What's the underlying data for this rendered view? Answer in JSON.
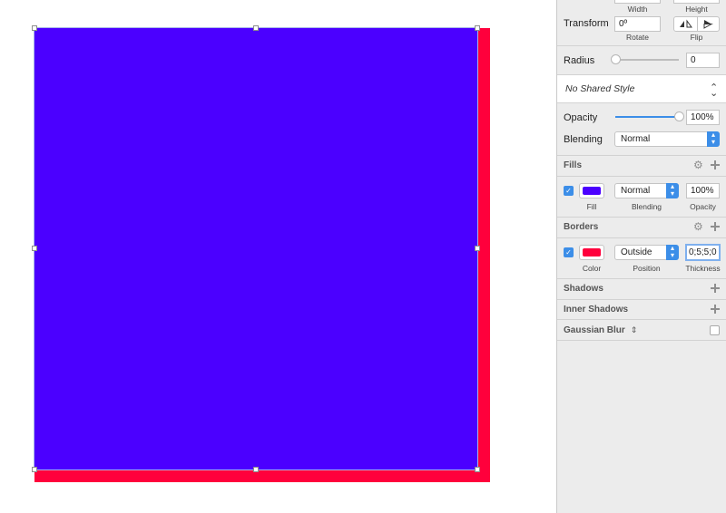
{
  "colors": {
    "fill": "#4b00ff",
    "border": "#ff003c",
    "accent": "#3c8ee8"
  },
  "size": {
    "width_label": "Width",
    "height_label": "Height"
  },
  "transform": {
    "label": "Transform",
    "rotate_value": "0º",
    "rotate_label": "Rotate",
    "flip_label": "Flip"
  },
  "radius": {
    "label": "Radius",
    "value": "0",
    "slider_fraction": 0
  },
  "shared_style": {
    "value": "No Shared Style"
  },
  "opacity": {
    "label": "Opacity",
    "value": "100%",
    "slider_fraction": 1.0
  },
  "blending": {
    "label": "Blending",
    "value": "Normal"
  },
  "fills": {
    "title": "Fills",
    "item": {
      "enabled": true,
      "blending": "Normal",
      "opacity": "100%",
      "fill_label": "Fill",
      "blending_label": "Blending",
      "opacity_label": "Opacity"
    }
  },
  "borders": {
    "title": "Borders",
    "item": {
      "enabled": true,
      "position": "Outside",
      "thickness": "0;5;5;0",
      "color_label": "Color",
      "position_label": "Position",
      "thickness_label": "Thickness"
    }
  },
  "shadows": {
    "title": "Shadows"
  },
  "inner_shadows": {
    "title": "Inner Shadows"
  },
  "gaussian_blur": {
    "title": "Gaussian Blur",
    "enabled": false
  }
}
